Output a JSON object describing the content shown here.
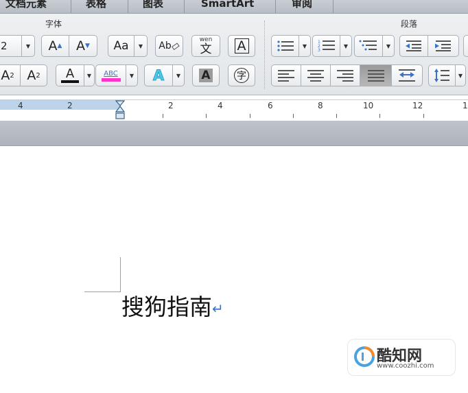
{
  "tabs": [
    "文档元素",
    "表格",
    "图表",
    "SmartArt",
    "审阅"
  ],
  "groups": {
    "font": "字体",
    "paragraph": "段落"
  },
  "font": {
    "size_value": "2",
    "grow": "A",
    "shrink": "A",
    "change_case": "Aa",
    "clear_format": "Ab",
    "phonetic_top": "wen",
    "phonetic_bottom": "文",
    "char_border": "A",
    "superscript": "A",
    "superscript_mark": "2",
    "subscript": "A",
    "subscript_mark": "2",
    "font_color": "A",
    "highlight": "ABC",
    "text_effects": "A",
    "char_shading": "A",
    "enclose_char": "字"
  },
  "ruler": {
    "numbers": [
      "4",
      "2",
      "2",
      "4",
      "6",
      "8",
      "10",
      "12",
      "1"
    ]
  },
  "document": {
    "text": "搜狗指南",
    "paragraph_mark": "↵"
  },
  "watermark": {
    "name": "酷知网",
    "url": "www.coozhi.com"
  },
  "colors": {
    "font_color_bar": "#111111",
    "highlight_bar": "#ff33cc",
    "effects": "#4ec9e8",
    "ruler_active": "#bcd3ea",
    "paragraph_mark": "#3a73c6"
  }
}
